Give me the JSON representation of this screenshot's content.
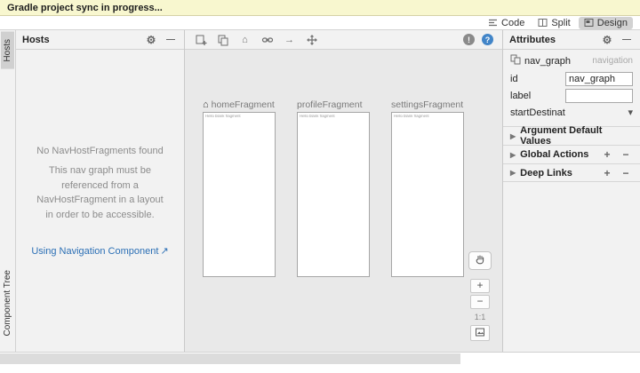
{
  "banner": {
    "text": "Gradle project sync in progress..."
  },
  "editor_tabs": {
    "code": "Code",
    "split": "Split",
    "design": "Design"
  },
  "left_strip": {
    "hosts_tab": "Hosts",
    "component_tree_tab": "Component Tree"
  },
  "hosts_panel": {
    "title": "Hosts",
    "empty_line1": "No NavHostFragments found",
    "empty_line2": "This nav graph must be referenced from a NavHostFragment in a layout in order to be accessible.",
    "link_text": "Using Navigation Component",
    "link_arrow": "↗"
  },
  "canvas": {
    "fragments": [
      {
        "name": "homeFragment",
        "preview_text": "Hello blank fragment"
      },
      {
        "name": "profileFragment",
        "preview_text": "Hello blank fragment"
      },
      {
        "name": "settingsFragment",
        "preview_text": "Hello blank fragment"
      }
    ],
    "zoom_controls": {
      "zoom_in": "+",
      "zoom_out": "−",
      "zoom_ratio": "1:1"
    }
  },
  "attributes_panel": {
    "title": "Attributes",
    "component_name": "nav_graph",
    "component_type": "navigation",
    "fields": [
      {
        "label": "id",
        "value": "nav_graph"
      },
      {
        "label": "label",
        "value": ""
      },
      {
        "label": "startDestinati...",
        "value": ""
      }
    ],
    "sections": [
      {
        "label": "Argument Default Values"
      },
      {
        "label": "Global Actions"
      },
      {
        "label": "Deep Links"
      }
    ]
  },
  "icons": {
    "gear": "⚙",
    "minimize": "—",
    "home": "⌂",
    "arrow_right": "→",
    "info": "!",
    "help": "?",
    "disclosure": "▶",
    "plus": "+",
    "minus": "−",
    "dropdown": "▾"
  }
}
